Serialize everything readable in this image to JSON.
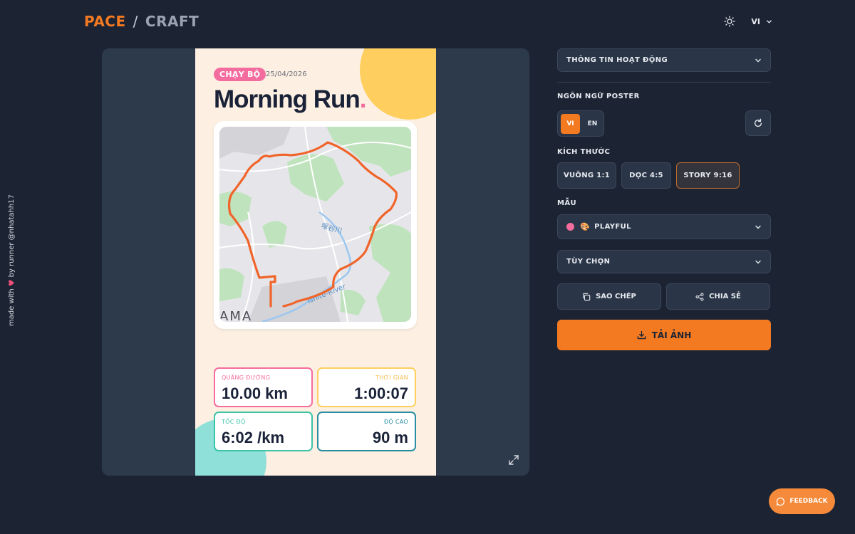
{
  "header": {
    "logo_pace": "PACE",
    "logo_slash": "/",
    "logo_craft": "CRAFT",
    "language": "VI"
  },
  "credit": {
    "prefix": "made with",
    "suffix": "by runner @nhatahh17"
  },
  "poster": {
    "tag": "CHẠY BỘ",
    "date": "25/04/2026",
    "title": "Morning Run",
    "title_dot": ".",
    "map_labels": {
      "river": "塚谷川",
      "road": "Ishite-River",
      "place": "AMA"
    },
    "stats": [
      {
        "label": "QUÃNG ĐƯỜNG",
        "value": "10.00 km"
      },
      {
        "label": "THỜI GIAN",
        "value": "1:00:07"
      },
      {
        "label": "TỐC ĐỘ",
        "value": "6:02 /km"
      },
      {
        "label": "ĐỘ CAO",
        "value": "90 m"
      }
    ]
  },
  "panel": {
    "activity_info": "THÔNG TIN HOẠT ĐỘNG",
    "poster_language_label": "NGÔN NGỮ POSTER",
    "lang_vi": "VI",
    "lang_en": "EN",
    "size_label": "KÍCH THƯỚC",
    "sizes": [
      "VUÔNG 1:1",
      "DỌC 4:5",
      "STORY 9:16"
    ],
    "template_label": "MẪU",
    "template_icon": "🎨",
    "template_value": "PLAYFUL",
    "options": "TÙY CHỌN",
    "copy": "SAO CHÉP",
    "share": "CHIA SẺ",
    "download": "TẢI ẢNH"
  },
  "feedback": "FEEDBACK",
  "colors": {
    "accent": "#f47a22",
    "background": "#1c2433",
    "panel": "#2a3647",
    "poster_bg": "#fdf0e3",
    "pink": "#f46c9e",
    "yellow": "#fecf5f",
    "teal": "#3cc3a8",
    "blue": "#2a8ea3",
    "route": "#f0642a"
  }
}
